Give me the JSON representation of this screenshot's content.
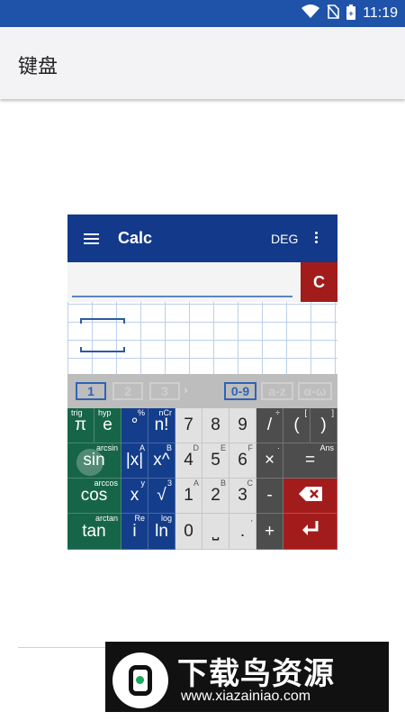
{
  "status_bar": {
    "time": "11:19",
    "icons": [
      "wifi-icon",
      "no-sim-icon",
      "battery-icon"
    ]
  },
  "app_bar": {
    "title": "键盘"
  },
  "calc": {
    "header": {
      "title": "Calc",
      "angle_mode": "DEG"
    },
    "clear_label": "C",
    "tabs": [
      {
        "label": "1",
        "active": true
      },
      {
        "label": "2",
        "active": false
      },
      {
        "label": "3",
        "active": false
      },
      {
        "label": "0-9",
        "active": true
      },
      {
        "label": "a-z",
        "active": false
      },
      {
        "label": "α-ω",
        "active": false
      }
    ],
    "keys": {
      "row1": [
        {
          "main": "π",
          "sub_left": "trig"
        },
        {
          "main": "e",
          "sub_left": "hyp"
        },
        {
          "main": "°",
          "sub_right": "%"
        },
        {
          "main": "n!",
          "sub_right": "nCr"
        },
        {
          "main": "7"
        },
        {
          "main": "8"
        },
        {
          "main": "9"
        },
        {
          "main": "/",
          "sub_right": "÷"
        },
        {
          "main": "(",
          "sub_right": "["
        },
        {
          "main": ")",
          "sub_right": "]"
        }
      ],
      "row2": [
        {
          "main": "sin",
          "sub_right": "arcsin"
        },
        {
          "main": "|x|",
          "sub_right": "A"
        },
        {
          "main": "x^",
          "sub_right": "B"
        },
        {
          "main": "4",
          "sub_right": "D"
        },
        {
          "main": "5",
          "sub_right": "E"
        },
        {
          "main": "6",
          "sub_right": "F"
        },
        {
          "main": "×",
          "sub_right": "·"
        },
        {
          "main": "=",
          "sub_right": "Ans"
        }
      ],
      "row3": [
        {
          "main": "cos",
          "sub_right": "arccos"
        },
        {
          "main": "x",
          "sub_right": "y"
        },
        {
          "main": "√",
          "sub_right": "3"
        },
        {
          "main": "1",
          "sub_right": "A"
        },
        {
          "main": "2",
          "sub_right": "B"
        },
        {
          "main": "3",
          "sub_right": "C"
        },
        {
          "main": "-"
        }
      ],
      "row4": [
        {
          "main": "tan",
          "sub_right": "arctan"
        },
        {
          "main": "i",
          "sub_right": "Re"
        },
        {
          "main": "ln",
          "sub_right": "log"
        },
        {
          "main": "0"
        },
        {
          "main": "⎵"
        },
        {
          "main": ".",
          "sub_right": ","
        },
        {
          "main": "+"
        }
      ]
    }
  },
  "watermark": {
    "title": "下载鸟资源",
    "url": "www.xiazainiao.com"
  },
  "colors": {
    "status_bar": "#1f53a9",
    "calc_header": "#13398a",
    "clear": "#a31c1c",
    "green_keys": "#176549",
    "navy_keys": "#143e8c",
    "dark_keys": "#4d4d4d",
    "tab_active": "#2f63b5"
  }
}
